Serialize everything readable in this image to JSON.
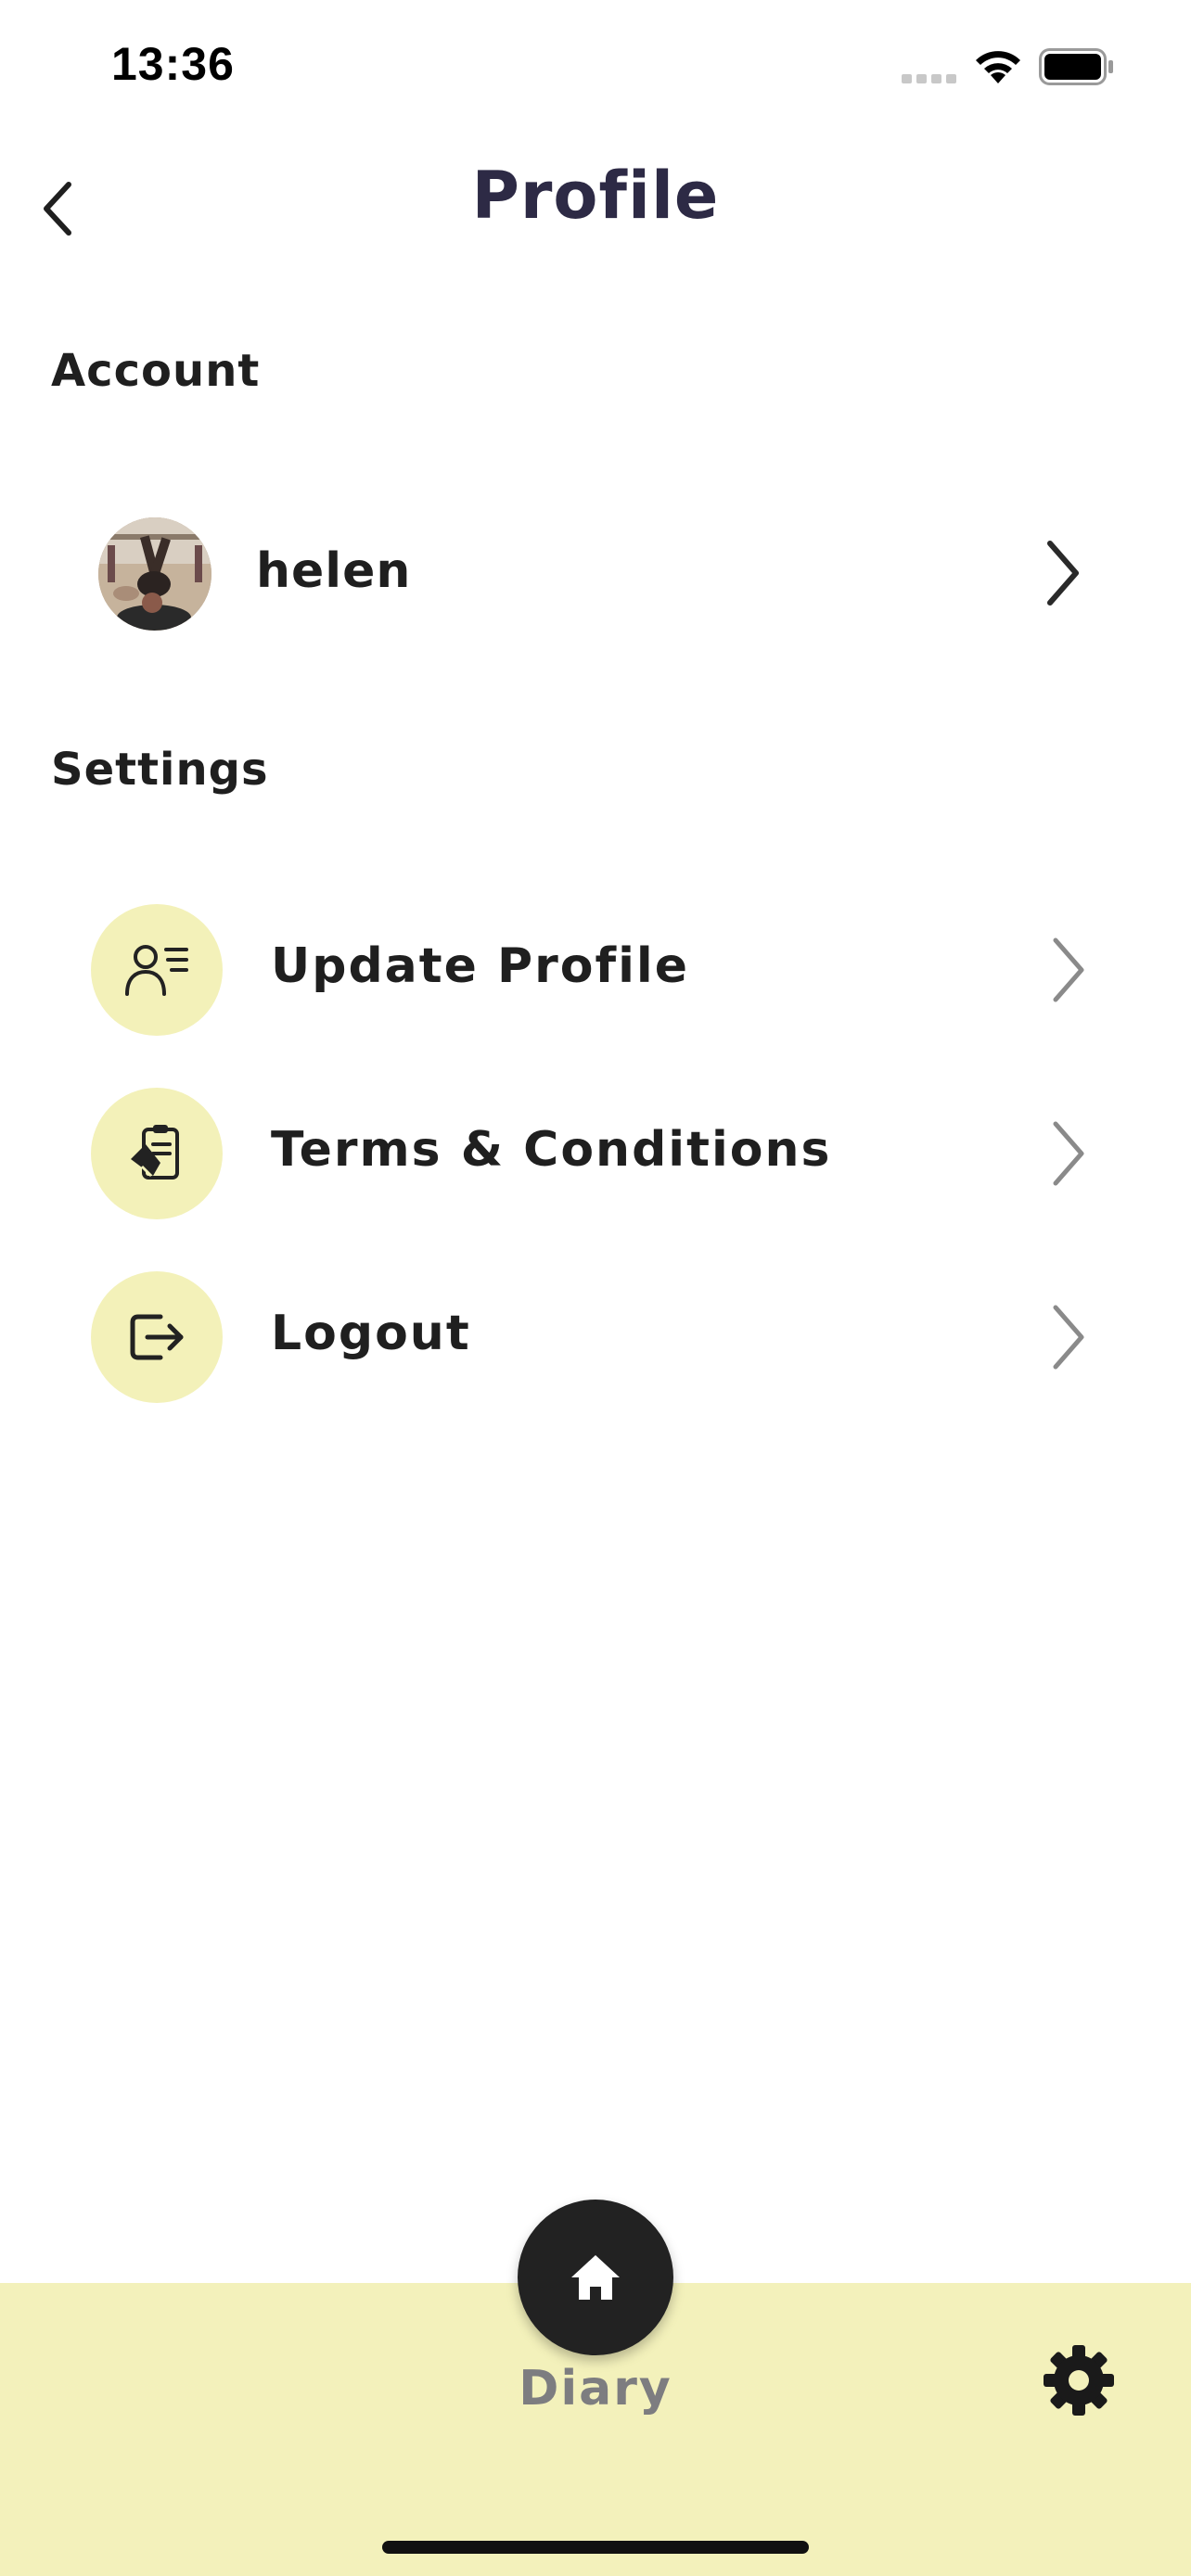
{
  "status_bar": {
    "time": "13:36"
  },
  "header": {
    "title": "Profile",
    "back_icon": "chevron-left-icon"
  },
  "account_section": {
    "label": "Account",
    "user": {
      "name": "helen",
      "avatar_icon": "avatar-photo"
    }
  },
  "settings_section": {
    "label": "Settings",
    "items": [
      {
        "label": "Update Profile",
        "icon": "user-details-icon"
      },
      {
        "label": "Terms & Conditions",
        "icon": "clipboard-icon"
      },
      {
        "label": "Logout",
        "icon": "logout-icon"
      }
    ]
  },
  "bottom_nav": {
    "home_icon": "home-icon",
    "home_label": "Diary",
    "settings_icon": "gear-icon"
  },
  "colors": {
    "title": "#2d2a45",
    "accent_yellow": "#f3f1b9",
    "fab": "#222222",
    "nav_label": "#7d7d80"
  }
}
